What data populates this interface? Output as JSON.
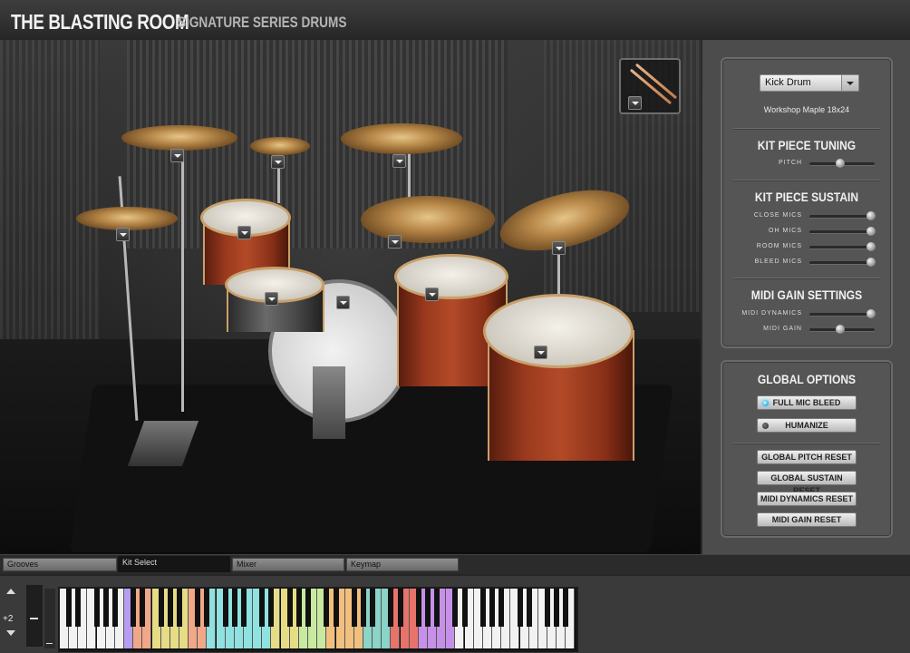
{
  "app": {
    "title": "THE BLASTING ROOM",
    "subtitle": "SIGNATURE SERIES DRUMS"
  },
  "sidebar": {
    "kit_piece_select": "Kick Drum",
    "kit_piece_name": "Workshop Maple 18x24",
    "tuning": {
      "title": "KIT PIECE TUNING",
      "sliders": [
        {
          "label": "PITCH",
          "value": 0.5
        }
      ]
    },
    "sustain": {
      "title": "KIT PIECE SUSTAIN",
      "sliders": [
        {
          "label": "CLOSE MICS",
          "value": 1.0
        },
        {
          "label": "OH MICS",
          "value": 1.0
        },
        {
          "label": "ROOM MICS",
          "value": 1.0
        },
        {
          "label": "BLEED MICS",
          "value": 1.0
        }
      ]
    },
    "midi": {
      "title": "MIDI GAIN SETTINGS",
      "sliders": [
        {
          "label": "MIDI DYNAMICS",
          "value": 1.0
        },
        {
          "label": "MIDI GAIN",
          "value": 0.5
        }
      ]
    },
    "global": {
      "title": "GLOBAL OPTIONS",
      "toggles": [
        {
          "label": "FULL MIC BLEED",
          "on": true
        },
        {
          "label": "HUMANIZE",
          "on": false
        }
      ],
      "buttons": [
        "GLOBAL PITCH RESET",
        "GLOBAL SUSTAIN RESET",
        "MIDI DYNAMICS RESET",
        "MIDI GAIN RESET"
      ]
    }
  },
  "tabs": [
    {
      "label": "Grooves",
      "active": false
    },
    {
      "label": "Kit Select",
      "active": true
    },
    {
      "label": "Mixer",
      "active": false
    },
    {
      "label": "Keymap",
      "active": false
    }
  ],
  "keyboard": {
    "octave_shift": "+2",
    "white_keys": 56,
    "colors": {
      "default": "#f2f2f2",
      "purple": "#b79df0",
      "salmon": "#f0a888",
      "yellow": "#e6dc86",
      "cyan": "#8fe2e0",
      "green": "#c9e9a0",
      "orange": "#f2c07e",
      "teal": "#8ad4c8",
      "red": "#e7736b",
      "violet": "#c790e8"
    },
    "colored_ranges": [
      {
        "from": 7,
        "to": 7,
        "color": "purple"
      },
      {
        "from": 8,
        "to": 9,
        "color": "salmon"
      },
      {
        "from": 10,
        "to": 13,
        "color": "yellow"
      },
      {
        "from": 14,
        "to": 15,
        "color": "salmon"
      },
      {
        "from": 16,
        "to": 22,
        "color": "cyan"
      },
      {
        "from": 23,
        "to": 25,
        "color": "yellow"
      },
      {
        "from": 26,
        "to": 28,
        "color": "green"
      },
      {
        "from": 29,
        "to": 32,
        "color": "orange"
      },
      {
        "from": 33,
        "to": 35,
        "color": "teal"
      },
      {
        "from": 36,
        "to": 38,
        "color": "red"
      },
      {
        "from": 39,
        "to": 42,
        "color": "violet"
      }
    ]
  },
  "stage": {
    "piece_menus": [
      "crash-left",
      "hihat",
      "splash",
      "ride",
      "rack-tom-1",
      "snare",
      "kick",
      "crash-china-main",
      "china",
      "floor-tom-1",
      "floor-tom-2"
    ]
  }
}
